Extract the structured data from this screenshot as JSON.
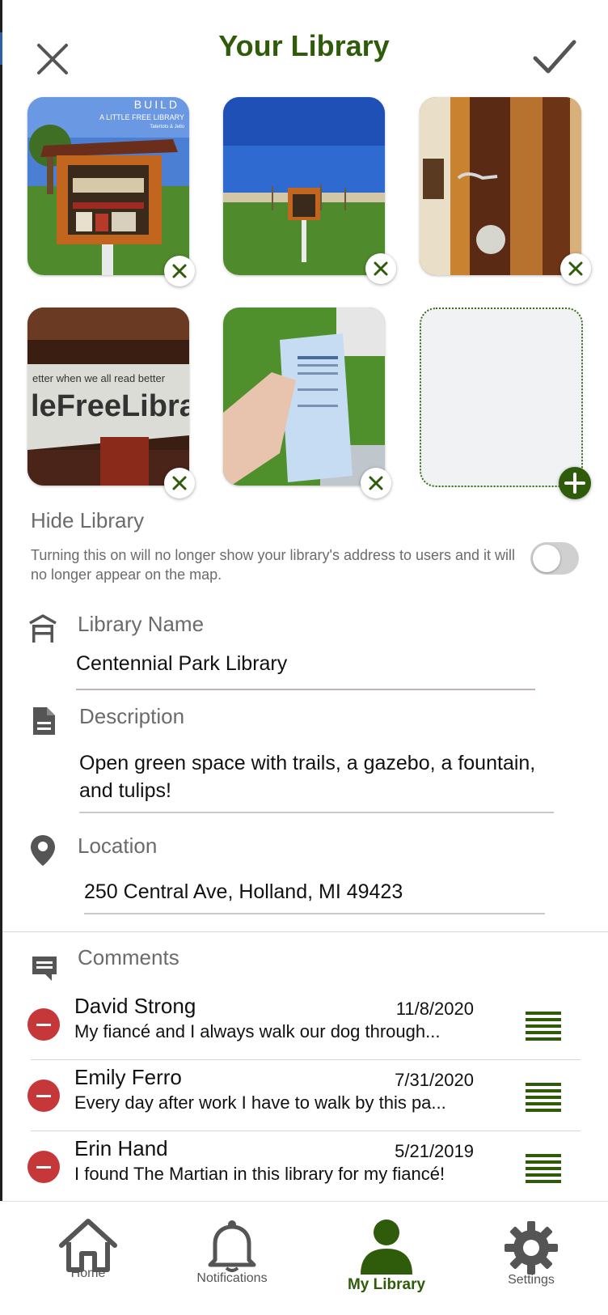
{
  "header": {
    "title": "Your Library",
    "close_icon": "close-icon",
    "confirm_icon": "checkmark-icon"
  },
  "photos": {
    "items": [
      {
        "description": "build-little-free-library-photo",
        "overlay_line1": "BUILD",
        "overlay_line2": "A LITTLE FREE LIBRARY",
        "overlay_line3": "Tatertots & Jello"
      },
      {
        "description": "library-in-park-photo"
      },
      {
        "description": "wood-latch-closeup-photo"
      },
      {
        "description": "little-free-library-sign-photo"
      },
      {
        "description": "library-flyer-in-hand-photo"
      }
    ],
    "remove_icon": "close-x-icon",
    "add_icon": "plus-icon"
  },
  "hide_library": {
    "title": "Hide Library",
    "description": "Turning this on will no longer show your library's address to users and it will no longer appear on the map.",
    "enabled": false
  },
  "fields": {
    "name": {
      "label": "Library Name",
      "value": "Centennial Park Library",
      "icon": "library-icon"
    },
    "description": {
      "label": "Description",
      "value": "Open green space with trails, a gazebo, a fountain, and tulips!",
      "icon": "document-icon"
    },
    "location": {
      "label": "Location",
      "value": "250 Central Ave, Holland, MI 49423",
      "icon": "location-pin-icon"
    }
  },
  "comments": {
    "label": "Comments",
    "icon": "comment-icon",
    "items": [
      {
        "name": "David Strong",
        "date": "11/8/2020",
        "text": "My fiancé and I always walk our dog through..."
      },
      {
        "name": "Emily Ferro",
        "date": "7/31/2020",
        "text": "Every day after work I have to walk by this pa..."
      },
      {
        "name": "Erin Hand",
        "date": "5/21/2019",
        "text": "I found The Martian in this library for my fiancé!"
      }
    ]
  },
  "nav": {
    "items": [
      {
        "label": "Home",
        "icon": "home-icon",
        "active": false
      },
      {
        "label": "Notifications",
        "icon": "bell-icon",
        "active": false
      },
      {
        "label": "My Library",
        "icon": "person-icon",
        "active": true
      },
      {
        "label": "Settings",
        "icon": "gear-icon",
        "active": false
      }
    ]
  },
  "colors": {
    "brand_green": "#2f5c0a",
    "delete_red": "#c6373a",
    "muted_text": "#6b6b6b"
  }
}
